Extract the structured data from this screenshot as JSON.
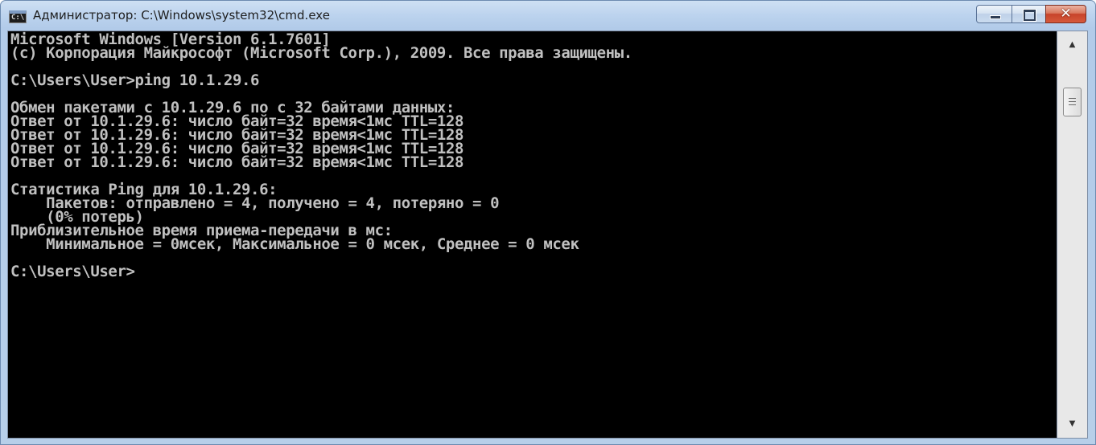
{
  "window": {
    "title": "Администратор: C:\\Windows\\system32\\cmd.exe",
    "icon_text": "C:\\",
    "controls": {
      "close_glyph": "✕"
    }
  },
  "console": {
    "lines": [
      "Microsoft Windows [Version 6.1.7601]",
      "(c) Корпорация Майкрософт (Microsoft Corp.), 2009. Все права защищены.",
      "",
      "C:\\Users\\User>ping 10.1.29.6",
      "",
      "Обмен пакетами с 10.1.29.6 по с 32 байтами данных:",
      "Ответ от 10.1.29.6: число байт=32 время<1мс TTL=128",
      "Ответ от 10.1.29.6: число байт=32 время<1мс TTL=128",
      "Ответ от 10.1.29.6: число байт=32 время<1мс TTL=128",
      "Ответ от 10.1.29.6: число байт=32 время<1мс TTL=128",
      "",
      "Статистика Ping для 10.1.29.6:",
      "    Пакетов: отправлено = 4, получено = 4, потеряно = 0",
      "    (0% потерь)",
      "Приблизительное время приема-передачи в мс:",
      "    Минимальное = 0мсек, Максимальное = 0 мсек, Среднее = 0 мсек",
      "",
      "C:\\Users\\User>"
    ]
  },
  "scrollbar": {
    "up_glyph": "▲",
    "down_glyph": "▼"
  }
}
